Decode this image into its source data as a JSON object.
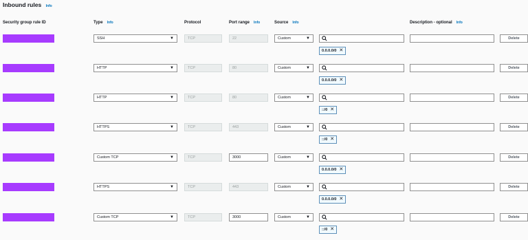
{
  "section": {
    "title": "Inbound rules",
    "info": "Info"
  },
  "headers": {
    "sg_rule_id": "Security group rule ID",
    "type": "Type",
    "type_info": "Info",
    "protocol": "Protocol",
    "port_range": "Port range",
    "port_info": "Info",
    "source": "Source",
    "source_info": "Info",
    "description": "Description - optional",
    "description_info": "Info"
  },
  "rules": [
    {
      "type": "SSH",
      "protocol": "TCP",
      "port": "22",
      "port_editable": false,
      "source": "Custom",
      "cidr": "0.0.0.0/0",
      "delete": "Delete"
    },
    {
      "type": "HTTP",
      "protocol": "TCP",
      "port": "80",
      "port_editable": false,
      "source": "Custom",
      "cidr": "0.0.0.0/0",
      "delete": "Delete"
    },
    {
      "type": "HTTP",
      "protocol": "TCP",
      "port": "80",
      "port_editable": false,
      "source": "Custom",
      "cidr": "::/0",
      "delete": "Delete"
    },
    {
      "type": "HTTPS",
      "protocol": "TCP",
      "port": "443",
      "port_editable": false,
      "source": "Custom",
      "cidr": "::/0",
      "delete": "Delete"
    },
    {
      "type": "Custom TCP",
      "protocol": "TCP",
      "port": "3000",
      "port_editable": true,
      "source": "Custom",
      "cidr": "0.0.0.0/0",
      "delete": "Delete"
    },
    {
      "type": "HTTPS",
      "protocol": "TCP",
      "port": "443",
      "port_editable": false,
      "source": "Custom",
      "cidr": "0.0.0.0/0",
      "delete": "Delete"
    },
    {
      "type": "Custom TCP",
      "protocol": "TCP",
      "port": "3000",
      "port_editable": true,
      "source": "Custom",
      "cidr": "::/0",
      "delete": "Delete"
    }
  ],
  "icons": {
    "caret": "caret-down-icon",
    "search": "search-icon",
    "remove": "close-icon"
  },
  "colors": {
    "redaction": "#a73bff",
    "info_link": "#0073bb",
    "token_border": "#5d8fb8"
  }
}
